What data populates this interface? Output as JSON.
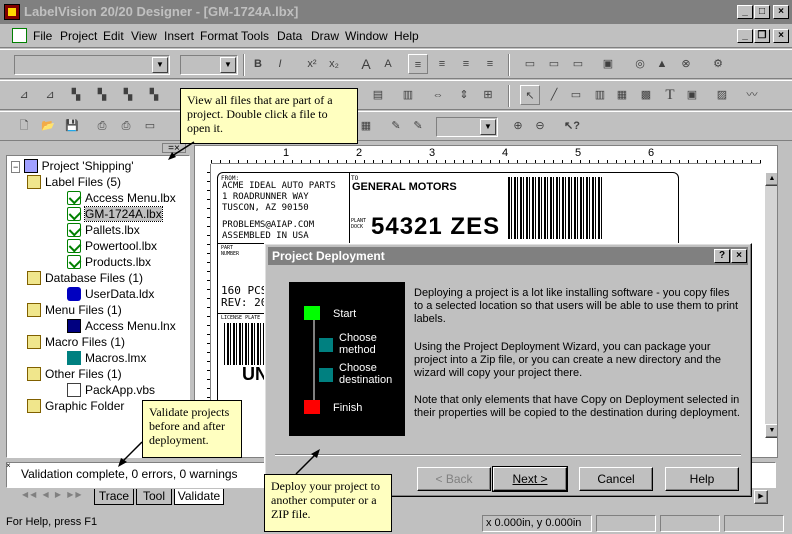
{
  "window": {
    "title": "LabelVision 20/20 Designer - [GM-1724A.lbx]"
  },
  "menu": [
    "File",
    "Project",
    "Edit",
    "View",
    "Insert",
    "Format",
    "Tools",
    "Data",
    "Draw",
    "Window",
    "Help"
  ],
  "tree": {
    "root": "Project 'Shipping'",
    "label_files": "Label Files (5)",
    "label_items": [
      "Access Menu.lbx",
      "GM-1724A.lbx",
      "Pallets.lbx",
      "Powertool.lbx",
      "Products.lbx"
    ],
    "database_files": "Database Files (1)",
    "database_items": [
      "UserData.ldx"
    ],
    "menu_files": "Menu Files (1)",
    "menu_items": [
      "Access Menu.lnx"
    ],
    "macro_files": "Macro Files (1)",
    "macro_items": [
      "Macros.lmx"
    ],
    "other_files": "Other Files (1)",
    "other_items": [
      "PackApp.vbs"
    ],
    "graphic_folder": "Graphic Folder"
  },
  "tooltips": {
    "view_files": "View all files that are part of a project. Double click a file to open it.",
    "validate": "Validate projects before and after deployment.",
    "deploy": "Deploy your project to another computer or a ZIP file."
  },
  "ruler": {
    "marks": [
      "1",
      "2",
      "3",
      "4",
      "5",
      "6"
    ]
  },
  "label": {
    "from_tag": "FROM:",
    "from_lines": [
      "ACME IDEAL AUTO PARTS",
      "1 ROADRUNNER WAY",
      "TUSCON, AZ  90150",
      "",
      "PROBLEMS@AIAP.COM",
      "ASSEMBLED IN USA"
    ],
    "to_tag": "TO",
    "to_company": "GENERAL MOTORS",
    "plant_tag": "PLANT DOCK",
    "plant_code": "54321 ZES",
    "part_tag": "PART NUMBER",
    "pcs": "160 PCS",
    "rev": "REV: 20",
    "license_tag": "LICENSE PLATE",
    "un": "UN"
  },
  "dialog": {
    "title": "Project Deployment",
    "help_btn": "?",
    "close_btn": "×",
    "steps": [
      "Start",
      "Choose method",
      "Choose destination",
      "Finish"
    ],
    "para1": "Deploying a project is a lot like installing software - you copy files to a selected location so that users will be able to use them to print labels.",
    "para2": "Using the Project Deployment Wizard, you can package your project into a Zip file, or you can create a new directory and the wizard will copy your project there.",
    "para3": "Note that only elements that have Copy on Deployment selected in their properties will be copied to the destination during deployment.",
    "back": "< Back",
    "next": "Next >",
    "cancel": "Cancel",
    "help": "Help"
  },
  "output": {
    "message": "Validation complete, 0 errors, 0 warnings"
  },
  "tabs": [
    "Trace",
    "Tool",
    "Validate"
  ],
  "status": {
    "help": "For Help, press F1",
    "coords": "x 0.000in,  y 0.000in"
  }
}
